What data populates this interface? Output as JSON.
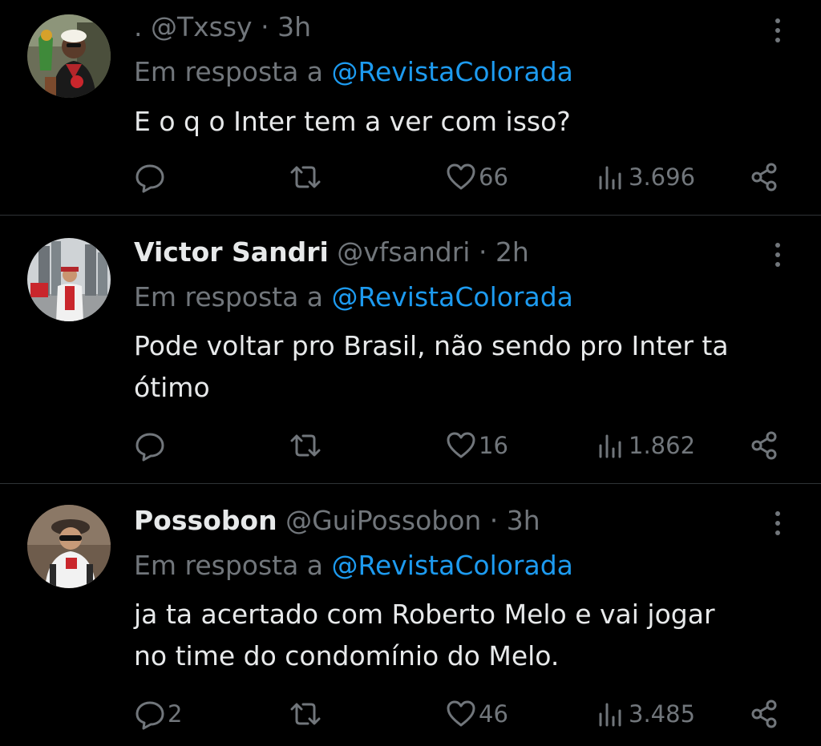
{
  "tweets": [
    {
      "name": "",
      "handle": ". @Txssy",
      "time": "3h",
      "reply_prefix": "Em resposta a ",
      "reply_to": "@RevistaColorada",
      "text": "E o q o Inter tem a ver com isso?",
      "replies": "",
      "retweets": "",
      "likes": "66",
      "views": "3.696"
    },
    {
      "name": "Victor Sandri",
      "handle": "@vfsandri",
      "time": "2h",
      "reply_prefix": "Em resposta a ",
      "reply_to": "@RevistaColorada",
      "text_line1": "Pode voltar pro Brasil, não sendo pro Inter ta",
      "text_line2": "ótimo",
      "replies": "",
      "retweets": "",
      "likes": "16",
      "views": "1.862"
    },
    {
      "name": "Possobon",
      "handle": "@GuiPossobon",
      "time": "3h",
      "reply_prefix": "Em resposta a ",
      "reply_to": "@RevistaColorada",
      "text_line1": "ja ta acertado com Roberto Melo e vai jogar",
      "text_line2": "no time do condomínio do Melo.",
      "replies": "2",
      "retweets": "",
      "likes": "46",
      "views": "3.485"
    }
  ],
  "separator": " · ",
  "colors": {
    "background": "#000000",
    "text": "#e7e9ea",
    "muted": "#71767b",
    "link": "#1d9bf0",
    "divider": "#2f3336"
  },
  "icons": {
    "more": "more-vertical-icon",
    "reply": "reply-icon",
    "retweet": "retweet-icon",
    "like": "heart-icon",
    "views": "views-icon",
    "share": "share-icon"
  }
}
